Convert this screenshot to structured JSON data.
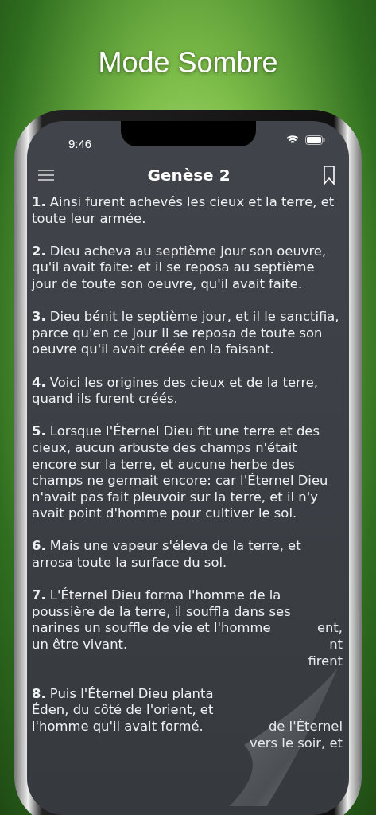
{
  "headline": "Mode Sombre",
  "status_bar": {
    "time": "9:46"
  },
  "nav": {
    "title": "Genèse 2"
  },
  "verses": [
    {
      "kind": "full",
      "number": "1.",
      "text": "Ainsi furent achevés les cieux et la terre, et toute leur armée."
    },
    {
      "kind": "full",
      "number": "2.",
      "text": "Dieu acheva au septième jour son oeuvre, qu'il avait faite: et il se reposa au septième jour de toute son oeuvre, qu'il avait faite."
    },
    {
      "kind": "full",
      "number": "3.",
      "text": "Dieu bénit le septième jour, et il le sanctifia, parce qu'en ce jour il se reposa de toute son oeuvre qu'il avait créée en la faisant."
    },
    {
      "kind": "full",
      "number": "4.",
      "text": "Voici les origines des cieux et de la terre, quand ils furent créés."
    },
    {
      "kind": "full",
      "number": "5.",
      "text": "Lorsque l'Éternel Dieu fit une terre et des cieux, aucun arbuste des champs n'était encore sur la terre, et aucune herbe des champs ne germait encore: car l'Éternel Dieu n'avait pas fait pleuvoir sur la terre, et il n'y avait point d'homme pour cultiver le sol."
    },
    {
      "kind": "full",
      "number": "6.",
      "text": "Mais une vapeur s'éleva de la terre, et arrosa toute la surface du sol."
    },
    {
      "kind": "curled",
      "number": "7.",
      "lines": [
        {
          "text": "L'Éternel Dieu forma l'homme de la"
        },
        {
          "text": "poussière de la terre, il souffla dans ses"
        },
        {
          "text": "narines un souffle de vie et l'homme",
          "behind": "ent,"
        },
        {
          "text": "un être vivant.",
          "behind": "nt"
        },
        {
          "behind": "firent"
        }
      ]
    },
    {
      "kind": "curled",
      "number": "8.",
      "lines": [
        {
          "text": "Puis l'Éternel Dieu planta"
        },
        {
          "text": "Éden, du côté de l'orient, et"
        },
        {
          "text": "l'homme qu'il avait formé.",
          "behind": "de l'Éternel"
        },
        {
          "behind": "vers le soir, et"
        }
      ]
    }
  ]
}
